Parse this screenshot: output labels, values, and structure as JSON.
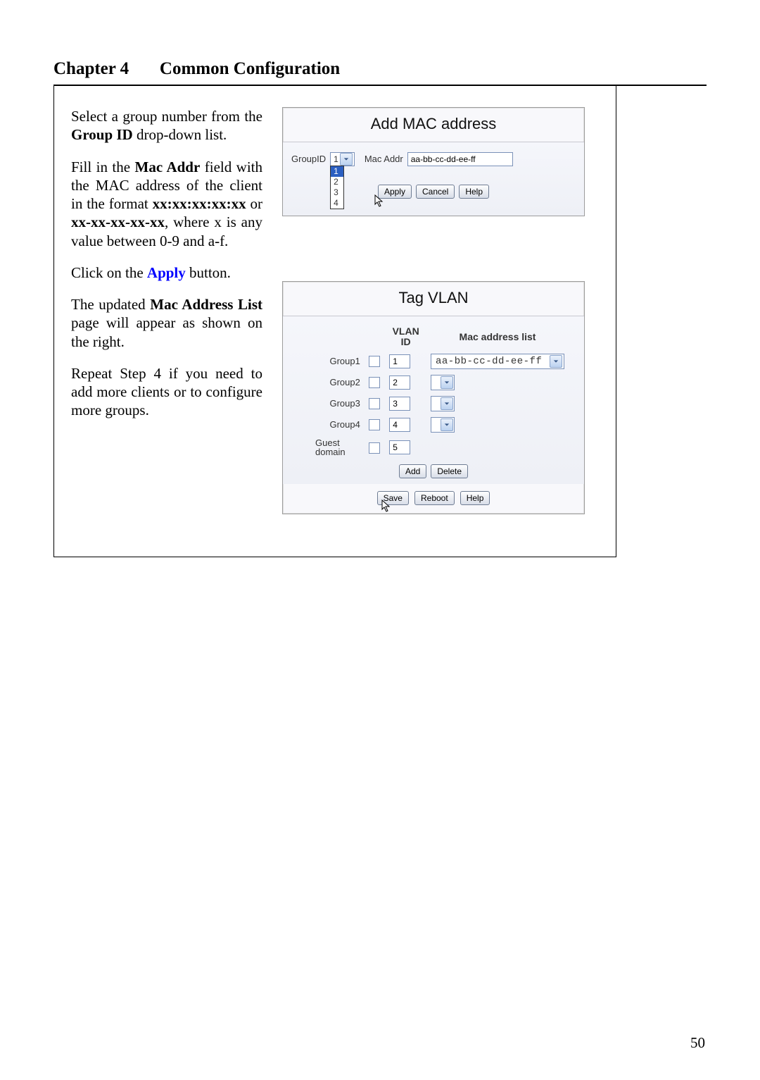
{
  "chapter": {
    "title": "Chapter 4       Common Configuration"
  },
  "instructions": {
    "p1_a": "Select a group number from the ",
    "p1_bold": "Group ID",
    "p1_b": " drop-down list.",
    "p2_a": "Fill in the ",
    "p2_bold1": "Mac Addr",
    "p2_b": " field with the MAC address of the client in the format ",
    "p2_bold2": "xx:xx:xx:xx:xx",
    "p2_c": " or ",
    "p2_bold3": "xx-xx-xx-xx-xx",
    "p2_d": ", where x is any value between 0-9 and a-f.",
    "p3_a": "Click on the ",
    "p3_link": "Apply",
    "p3_b": " button.",
    "p4_a": "The updated ",
    "p4_bold": "Mac Address List",
    "p4_b": " page will appear as shown on the right.",
    "p5": "Repeat Step 4 if you need to add more clients or to configure more groups."
  },
  "add_mac_panel": {
    "title": "Add MAC address",
    "group_id_label": "GroupID",
    "group_id_value": "1",
    "group_id_options": [
      "1",
      "2",
      "3",
      "4"
    ],
    "mac_addr_label": "Mac Addr",
    "mac_addr_value": "aa-bb-cc-dd-ee-ff",
    "apply": "Apply",
    "cancel": "Cancel",
    "help": "Help"
  },
  "tag_vlan_panel": {
    "title": "Tag VLAN",
    "col_vlan": "VLAN ID",
    "col_mac": "Mac address list",
    "groups": [
      {
        "name": "Group1",
        "vlan": "1",
        "mac": "aa-bb-cc-dd-ee-ff",
        "has_mac_select": true
      },
      {
        "name": "Group2",
        "vlan": "2",
        "has_mac_select": true
      },
      {
        "name": "Group3",
        "vlan": "3",
        "has_mac_select": true
      },
      {
        "name": "Group4",
        "vlan": "4",
        "has_mac_select": true
      },
      {
        "name": "Guest domain",
        "vlan": "5",
        "has_mac_select": false
      }
    ],
    "add": "Add",
    "delete": "Delete",
    "save": "Save",
    "reboot": "Reboot",
    "help": "Help"
  },
  "page_number": "50"
}
